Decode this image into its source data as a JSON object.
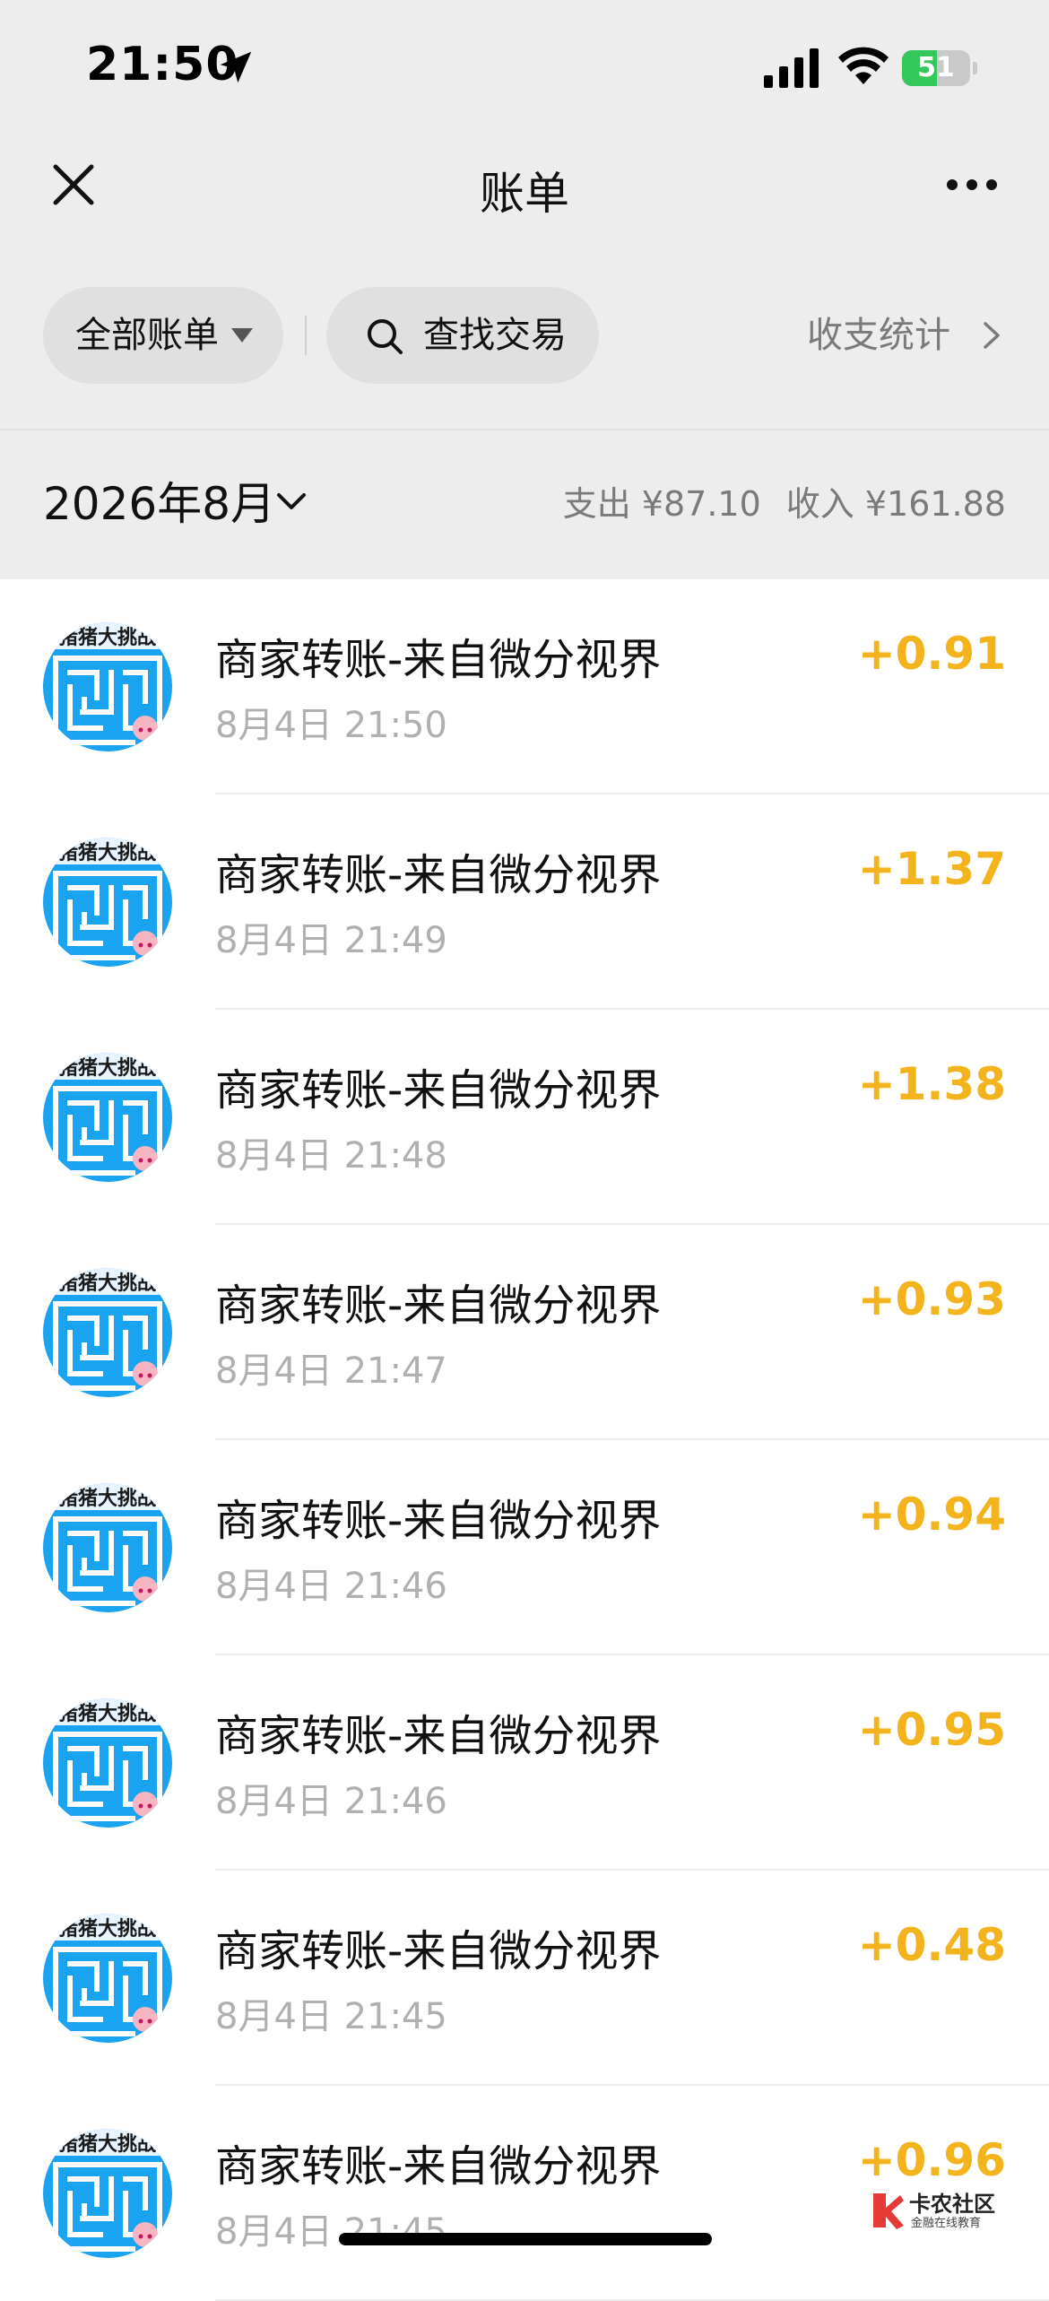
{
  "status_bar": {
    "time": "21:50",
    "battery_percent": "51",
    "battery_level": 0.51,
    "battery_color": "#34c759"
  },
  "nav": {
    "title": "账单",
    "close_icon": "close-icon",
    "more_icon": "more-icon"
  },
  "filters": {
    "all_bills": "全部账单",
    "search": "查找交易",
    "stats": "收支统计"
  },
  "month": {
    "label": "2026年8月",
    "expense": "支出 ¥87.10",
    "income": "收入 ¥161.88"
  },
  "colors": {
    "amount": "#f3b31c",
    "avatar_blue": "#1aa3f0",
    "header_bg": "#ededed"
  },
  "transactions": [
    {
      "title": "商家转账-来自微分视界",
      "time": "8月4日 21:50",
      "amount": "+0.91"
    },
    {
      "title": "商家转账-来自微分视界",
      "time": "8月4日 21:49",
      "amount": "+1.37"
    },
    {
      "title": "商家转账-来自微分视界",
      "time": "8月4日 21:48",
      "amount": "+1.38"
    },
    {
      "title": "商家转账-来自微分视界",
      "time": "8月4日 21:47",
      "amount": "+0.93"
    },
    {
      "title": "商家转账-来自微分视界",
      "time": "8月4日 21:46",
      "amount": "+0.94"
    },
    {
      "title": "商家转账-来自微分视界",
      "time": "8月4日 21:46",
      "amount": "+0.95"
    },
    {
      "title": "商家转账-来自微分视界",
      "time": "8月4日 21:45",
      "amount": "+0.48"
    },
    {
      "title": "商家转账-来自微分视界",
      "time": "8月4日 21:45",
      "amount": "+0.96"
    }
  ],
  "avatar_logo_text": "猪猪大挑战",
  "watermark": {
    "title": "卡农社区",
    "subtitle": "金融在线教育"
  }
}
